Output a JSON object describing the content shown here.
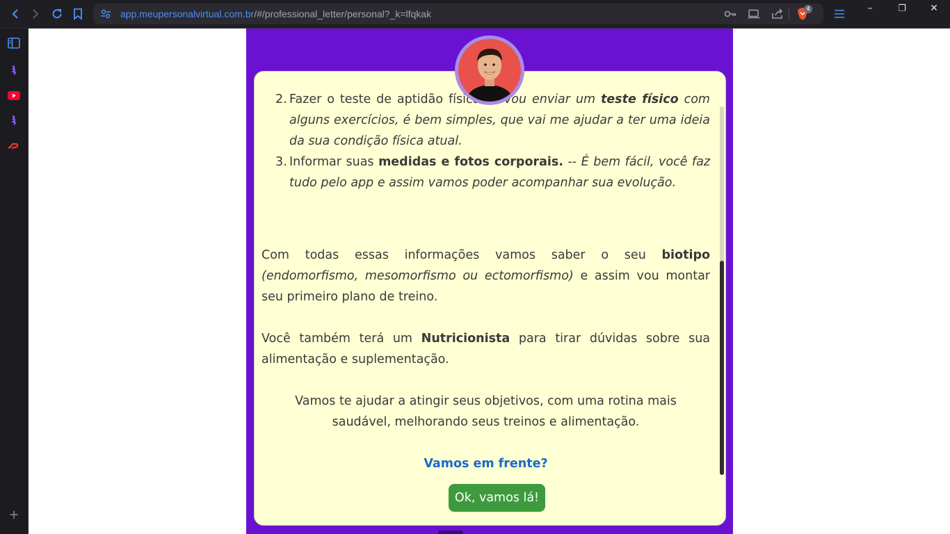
{
  "browser": {
    "url_host": "app.meupersonalvirtual.com.br",
    "url_path": "/#/professional_letter/personal?_k=lfqkak",
    "shield_badge": "4",
    "window_controls": {
      "minimize": "–",
      "restore": "❐",
      "close": "✕"
    }
  },
  "sidebar": {
    "add_label": "+"
  },
  "letter": {
    "item2": {
      "number": "2.",
      "lead": "Fazer o teste de aptidão física. -- ",
      "italic_a": "Vou enviar um ",
      "bold": "teste físico",
      "italic_b": " com alguns exercícios, é bem simples, que vai me ajudar a ter uma ideia da sua condição física atual."
    },
    "item3": {
      "number": "3.",
      "lead": "Informar suas ",
      "bold": "medidas e fotos corporais.",
      "sep": " -- ",
      "italic": "É bem fácil, você faz tudo pelo app e assim vamos poder acompanhar sua evolução."
    },
    "para1": {
      "text_a": "Com todas essas informações vamos saber o seu ",
      "bold": "biotipo",
      "italic": " (endomorfismo, mesomorfismo ou ectomorfismo)",
      "text_b": " e assim vou montar seu primeiro plano de treino."
    },
    "para2": {
      "text_a": "Você também terá um ",
      "bold": "Nutricionista",
      "text_b": " para tirar dúvidas sobre sua alimentação e suplementação."
    },
    "para3": "Vamos te ajudar a atingir seus objetivos, com uma rotina mais saudável, melhorando seus treinos e alimentação.",
    "cta_question": "Vamos em frente?",
    "cta_button": "Ok, vamos lá!"
  },
  "colors": {
    "purple_bg": "#6a12d1",
    "card_bg": "#ffffd4",
    "cta_blue": "#1b6ac9",
    "button_green": "#3d9a3d"
  }
}
